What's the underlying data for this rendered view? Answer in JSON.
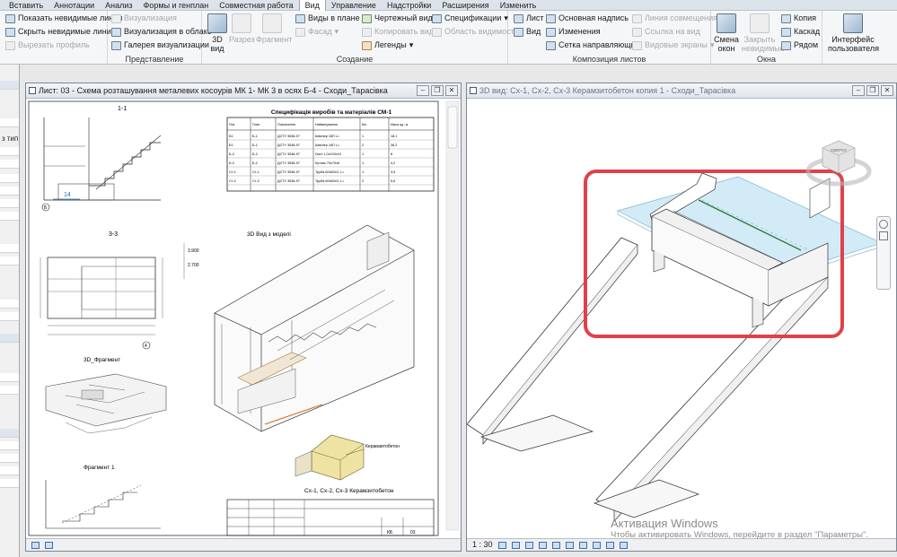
{
  "menu": [
    "Вставить",
    "Аннотации",
    "Анализ",
    "Формы и генплан",
    "Совместная работа",
    "Вид",
    "Управление",
    "Надстройки",
    "Расширения",
    "Изменить"
  ],
  "menu_active": "Вид",
  "ribbon": {
    "graphics": {
      "show_hidden": "Показать невидимые линии",
      "hide_hidden": "Скрыть невидимые линии",
      "cut_profile": "Вырезать профиль"
    },
    "presentation": {
      "title": "Представление",
      "visualization": "Визуализация",
      "cloud_render": "Визуализация  в облаке",
      "gallery": "Галерея  визуализации"
    },
    "create": {
      "title": "Создание",
      "view3d": "3D вид",
      "section": "Разрез",
      "callout": "Фрагмент",
      "plan_views": "Виды в плане",
      "elevation": "Фасад",
      "drafting": "Чертежный вид",
      "duplicate": "Копировать вид",
      "legends": "Легенды",
      "schedules": "Спецификации",
      "scope_box": "Область видимости"
    },
    "sheet": {
      "title": "Композиция листов",
      "sheet": "Лист",
      "view": "Вид",
      "title_block": "Основная надпись",
      "revisions": "Изменения",
      "guide_grid": "Сетка направляющих",
      "matchline": "Линия совмещения",
      "view_ref": "Ссылка на вид",
      "viewports": "Видовые экраны"
    },
    "windows": {
      "title": "Окна",
      "switch": "Смена окон",
      "close_hidden": "Закрыть невидимые",
      "replicate": "Копия",
      "cascade": "Каскад",
      "tile": "Рядом",
      "ui": "Интерфейс пользователя"
    }
  },
  "left_panel": {
    "type_label": "з тип"
  },
  "sheet_window": {
    "title": "Лист: 03 - Схема розташування металевих косоурів МК 1- МК 3 в осях Б-4 - Сходи_Тарасівка",
    "labels": {
      "s11": "1-1",
      "s33": "3-3",
      "fragment3d": "3D_Фрагмент",
      "fragment1": "Фрагмент 1",
      "view3d_model": "3D Вид з моделі",
      "schedule_title": "Специфікація виробів та матеріалів СМ-1",
      "caption_bottom": "Сх-1, Сх-2, Сх-3 Керамзитобетон",
      "keramz": "Керамзитобетон",
      "dim14": "14",
      "axisB": "Б",
      "axis4": "4",
      "tb_sheet": "КБ",
      "tb_num": "03"
    },
    "schedule_rows": [
      [
        "Б1",
        "Б-1",
        "ДСТУ 3536-97",
        "Швелер 16П L=",
        "1",
        "18,1"
      ],
      [
        "Б1",
        "Б-1",
        "ДСТУ 3536-97",
        "Швелер 16П L=",
        "2",
        "36,2"
      ],
      [
        "Б-2",
        "Б-2",
        "ДСТУ 3536-97",
        "Лист 1,0x100x10",
        "1",
        "8"
      ],
      [
        "Б-2",
        "Б-2",
        "ДСТУ 3536-97",
        "Кутник 70x70x6",
        "1",
        "4,2"
      ],
      [
        "Ст-1",
        "Ст-1",
        "ДСТУ 3536-97",
        "Труба 60x60x3, L=",
        "1",
        "3,5"
      ],
      [
        "Ст-2",
        "Ст-2",
        "ДСТУ 3536-97",
        "Труба 60x60x3, L=",
        "2",
        "5,6"
      ]
    ],
    "schedule_headers": [
      "Поз.",
      "Позн.",
      "Позначення",
      "Найменування",
      "Кіл.",
      "Маса од., кг"
    ]
  },
  "view_window": {
    "title": "3D вид: Сх-1, Сх-2, Сх-3 Керамзитобетон копия 1 - Сходи_Тарасівка",
    "scale": "1 : 30",
    "viewcube": "СВЕРХУ"
  },
  "activation": {
    "line1": "Активация Windows",
    "line2": "Чтобы активировать Windows, перейдите в раздел \"Параметры\"."
  },
  "colors": {
    "highlight": "#e0414a",
    "floor": "#bfe3f2",
    "accent": "#2a6bb0"
  }
}
